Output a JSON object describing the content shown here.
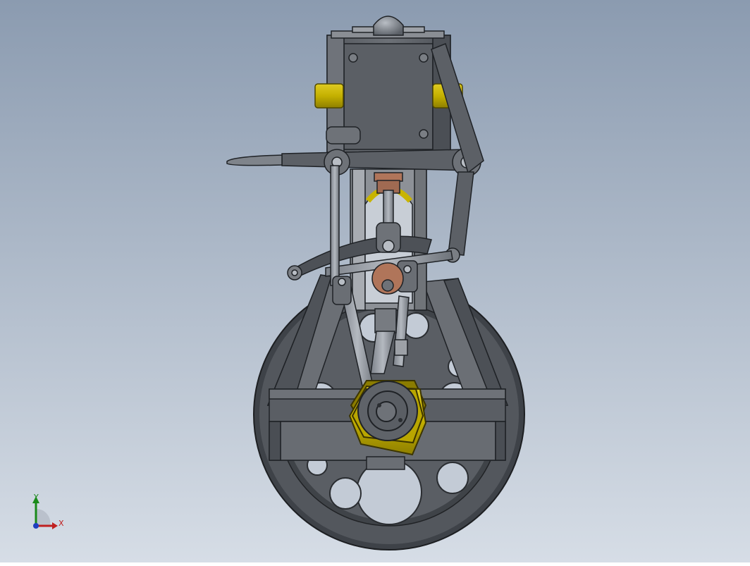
{
  "viewport": {
    "background_top": "#8d9db2",
    "background_bottom": "#d4dbe4",
    "model": "vertical-steam-engine"
  },
  "triad": {
    "x_label": "X",
    "y_label": "Y",
    "x_color": "#c02020",
    "y_color": "#1a8a1a",
    "z_color": "#1f3fbf"
  },
  "materials": {
    "frame_steel": "#5f6369",
    "brass": "#c8b400",
    "copper": "#b0755a"
  }
}
